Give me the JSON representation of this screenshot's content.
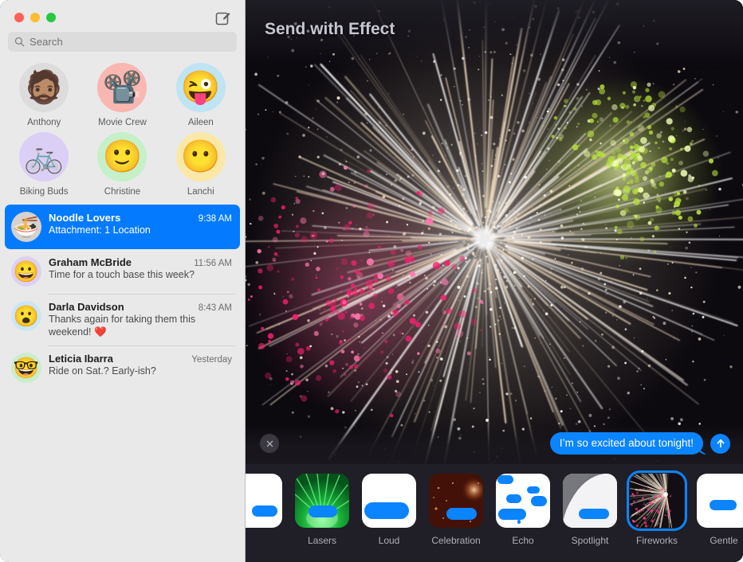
{
  "window": {
    "traffic_lights": [
      "close",
      "minimize",
      "zoom"
    ],
    "colors": {
      "accent_blue": "#047aff",
      "bubble_blue": "#0a84ff",
      "sidebar_bg": "#e9e9e9",
      "effectbar_bg": "#201e26",
      "preview_bg": "#0d0a10",
      "title_gray": "#c7c5d0"
    }
  },
  "sidebar": {
    "compose_icon": "compose-pencil-square-icon",
    "search": {
      "icon": "search-icon",
      "placeholder": "Search",
      "value": ""
    },
    "pinned": [
      {
        "label": "Anthony",
        "icon": "memoji-anthony",
        "glyph": "🧔🏽",
        "bg": "#dcdcdc"
      },
      {
        "label": "Movie Crew",
        "icon": "movie-projector",
        "glyph": "📽️",
        "bg": "#f8b7b0"
      },
      {
        "label": "Aileen",
        "icon": "memoji-aileen",
        "glyph": "😜",
        "bg": "#bfe4f4"
      },
      {
        "label": "Biking Buds",
        "icon": "bicycle",
        "glyph": "🚲",
        "bg": "#dccff5"
      },
      {
        "label": "Christine",
        "icon": "memoji-christine",
        "glyph": "🙂",
        "bg": "#c5f0c8"
      },
      {
        "label": "Lanchi",
        "icon": "memoji-lanchi",
        "glyph": "😶",
        "bg": "#fbe8a6"
      }
    ],
    "conversations": [
      {
        "name": "Noodle Lovers",
        "time": "9:38 AM",
        "preview": "Attachment: 1 Location",
        "selected": true,
        "avatar_icon": "ramen-bowl",
        "avatar_glyph": "🍜",
        "avatar_bg": "#d6d2cd"
      },
      {
        "name": "Graham McBride",
        "time": "11:56 AM",
        "preview": "Time for a touch base this week?",
        "selected": false,
        "avatar_icon": "memoji-graham",
        "avatar_glyph": "😀",
        "avatar_bg": "#ddd0f5"
      },
      {
        "name": "Darla Davidson",
        "time": "8:43 AM",
        "preview": "Thanks again for taking them this weekend! ❤️",
        "selected": false,
        "avatar_icon": "memoji-darla",
        "avatar_glyph": "😮",
        "avatar_bg": "#c9e7f6"
      },
      {
        "name": "Leticia Ibarra",
        "time": "Yesterday",
        "preview": "Ride on Sat.? Early-ish?",
        "selected": false,
        "avatar_icon": "memoji-leticia",
        "avatar_glyph": "🤓",
        "avatar_bg": "#c8eecb"
      }
    ]
  },
  "main": {
    "title": "Send with Effect",
    "close_icon": "close-x-icon",
    "send_icon": "send-arrow-up-icon",
    "message": {
      "text": "I’m so excited about tonight!",
      "outgoing": true
    },
    "preview_effect": "Fireworks"
  },
  "effects": {
    "selected": "Fireworks",
    "items": [
      {
        "label": "",
        "style": "cut-off",
        "selected": false
      },
      {
        "label": "Lasers",
        "style": "lasers",
        "selected": false
      },
      {
        "label": "Loud",
        "style": "loud",
        "selected": false
      },
      {
        "label": "Celebration",
        "style": "celebration",
        "selected": false
      },
      {
        "label": "Echo",
        "style": "echo",
        "selected": false
      },
      {
        "label": "Spotlight",
        "style": "spotlight",
        "selected": false
      },
      {
        "label": "Fireworks",
        "style": "fireworks",
        "selected": true
      },
      {
        "label": "Gentle",
        "style": "gentle",
        "selected": false
      }
    ]
  }
}
